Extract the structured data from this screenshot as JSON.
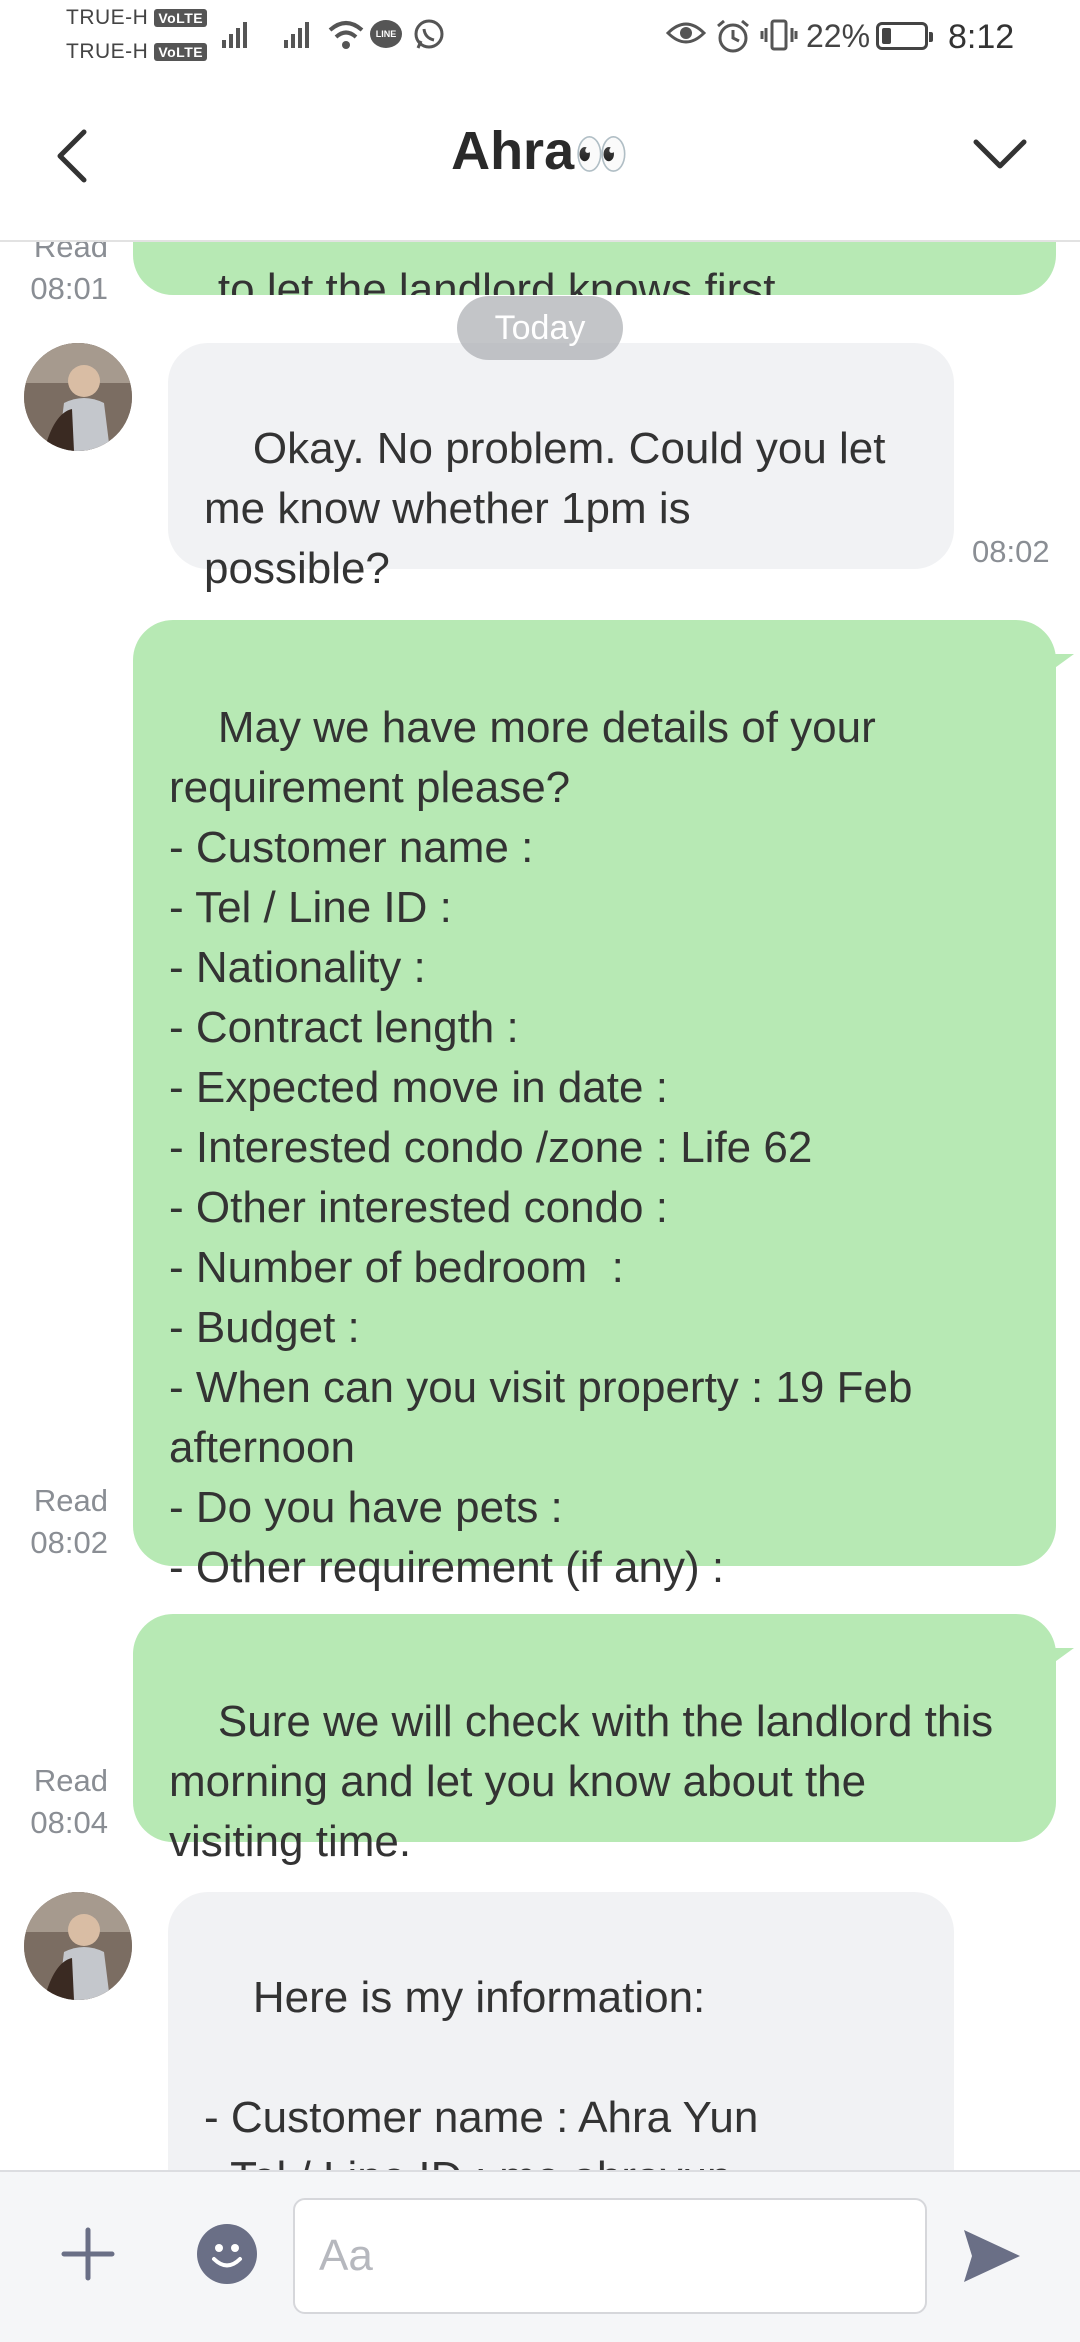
{
  "status_bar": {
    "carrier_1": "TRUE-H",
    "carrier_2": "TRUE-H",
    "volte_badge": "VoLTE",
    "line_badge": "LINE",
    "battery_text": "22%",
    "battery_level": 0.22,
    "time": "8:12",
    "icons": [
      "signal-icon",
      "wifi-icon",
      "line-app-icon",
      "whatsapp-icon",
      "eye-icon",
      "alarm-icon",
      "vibrate-icon",
      "battery-icon"
    ]
  },
  "header": {
    "title": "Ahra",
    "title_emoji": "👀"
  },
  "date_separator": "Today",
  "messages": [
    {
      "id": "m0",
      "direction": "outgoing",
      "text": "to let the landlord knows first.",
      "status": "Read",
      "time": "08:01"
    },
    {
      "id": "m1",
      "direction": "incoming",
      "text": "Okay. No problem. Could you let\nme know whether 1pm is\npossible?",
      "time": "08:02"
    },
    {
      "id": "m2",
      "direction": "outgoing",
      "text": "May we have more details of your\nrequirement please?\n- Customer name :\n- Tel / Line ID :\n- Nationality :\n- Contract length :\n- Expected move in date :\n- Interested condo /zone : Life 62\n- Other interested condo :\n- Number of bedroom  :\n- Budget :\n- When can you visit property : 19 Feb\nafternoon\n- Do you have pets :\n- Other requirement (if any) :",
      "status": "Read",
      "time": "08:02"
    },
    {
      "id": "m3",
      "direction": "outgoing",
      "text": "Sure we will check with the landlord this\nmorning and let you know about the\nvisiting time.",
      "status": "Read",
      "time": "08:04"
    },
    {
      "id": "m4",
      "direction": "incoming",
      "text": "Here is my information:\n\n- Customer name : Ahra Yun\n- Tel / Line ID : me.ahrayun\n- Nationality : South Korean"
    }
  ],
  "composer": {
    "placeholder": "Aa",
    "value": ""
  },
  "colors": {
    "outgoing_bubble": "#b7e9b4",
    "incoming_bubble": "#f1f2f4",
    "icon_accent": "#6a6f86"
  }
}
